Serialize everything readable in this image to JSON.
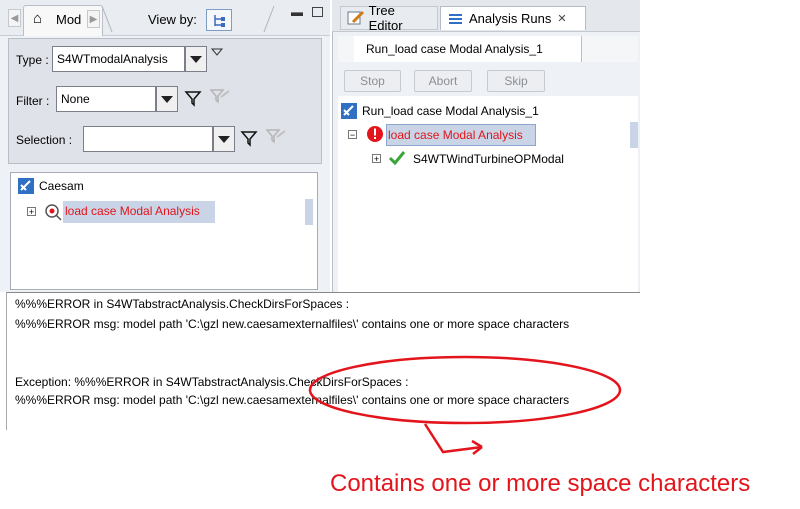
{
  "left_panel": {
    "tab_label": "Mod",
    "view_by_label": "View by:",
    "type_label": "Type :",
    "type_value": "S4WTmodalAnalysis",
    "filter_label": "Filter :",
    "filter_value": "None",
    "selection_label": "Selection :",
    "selection_value": "",
    "tree": {
      "root": "Caesam",
      "child": "load case Modal Analysis"
    }
  },
  "right_panel": {
    "tabs": [
      "Tree Editor",
      "Analysis Runs"
    ],
    "run_tab": "Run_load case Modal Analysis_1",
    "buttons": [
      "Stop",
      "Abort",
      "Skip"
    ],
    "tree": {
      "root": "Run_load case Modal Analysis_1",
      "child": "load case Modal Analysis",
      "grandchild": "S4WTWindTurbineOPModal"
    }
  },
  "console": {
    "lines": [
      "%%%ERROR in S4WTabstractAnalysis.CheckDirsForSpaces :",
      "%%%ERROR msg: model path 'C:\\gzl new.caesamexternalfiles\\' contains one or more space characters",
      "Exception: %%%ERROR in S4WTabstractAnalysis.CheckDirsForSpaces :",
      "%%%ERROR msg: model path 'C:\\gzl new.caesamexternalfiles\\' contains one or more space characters"
    ]
  },
  "annotation": {
    "caption": "Contains one or more space characters",
    "color": "#e3141b"
  },
  "colors": {
    "panel_bg": "#eef1f5",
    "selection_bg": "#c9d5e6",
    "error_red": "#e3141b"
  }
}
